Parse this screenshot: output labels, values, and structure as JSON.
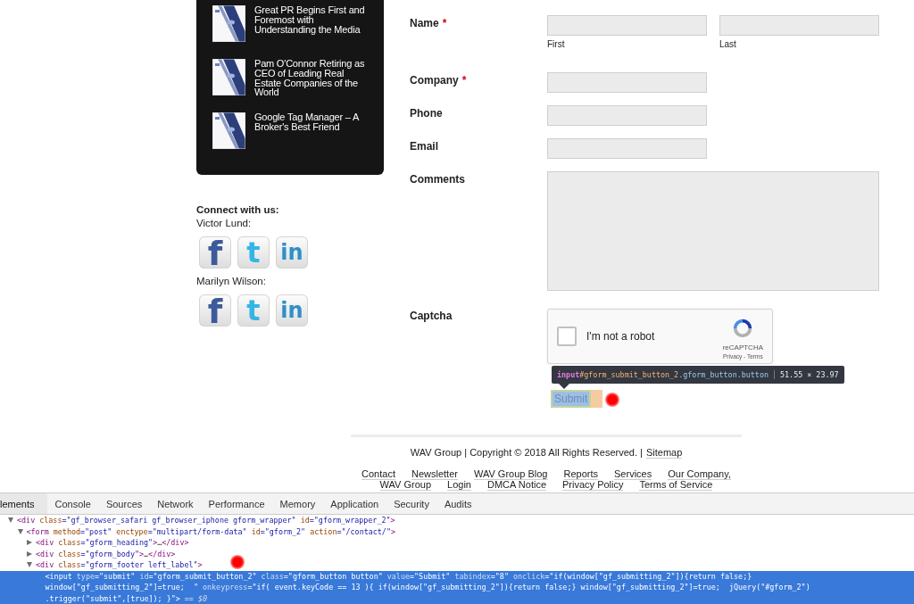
{
  "sidebar": {
    "posts": [
      {
        "title": "Great PR Begins First and Foremost with Understanding the Media"
      },
      {
        "title": "Pam O'Connor Retiring as CEO of Leading Real Estate Companies of the World"
      },
      {
        "title": "Google Tag Manager – A Broker's Best Friend"
      }
    ],
    "connect": {
      "heading": "Connect with us:",
      "people": [
        {
          "name": "Victor Lund:",
          "networks": [
            {
              "kind": "facebook",
              "glyph": "f"
            },
            {
              "kind": "twitter",
              "glyph": "t"
            },
            {
              "kind": "linkedin",
              "glyph": "in"
            }
          ]
        },
        {
          "name": "Marilyn Wilson:",
          "networks": [
            {
              "kind": "facebook",
              "glyph": "f"
            },
            {
              "kind": "twitter",
              "glyph": "t"
            },
            {
              "kind": "linkedin",
              "glyph": "in"
            }
          ]
        }
      ]
    }
  },
  "form": {
    "fields": [
      {
        "kind": "name",
        "label": "Name",
        "asterisk": "*",
        "sublabels": [
          "First",
          "Last"
        ]
      },
      {
        "kind": "text",
        "label": "Company",
        "asterisk": "*"
      },
      {
        "kind": "text",
        "label": "Phone"
      },
      {
        "kind": "text",
        "label": "Email"
      },
      {
        "kind": "textarea",
        "label": "Comments"
      },
      {
        "kind": "captcha",
        "label": "Captcha",
        "checked": false,
        "prompt": "I'm not a robot",
        "brand": "reCAPTCHA",
        "legal": "Privacy - Terms"
      }
    ],
    "inspector_tooltip": {
      "tag": "input",
      "id": "#gform_submit_button_2",
      "classes": ".gform_button.button",
      "size": "51.55 × 23.97"
    },
    "submit": {
      "label": "Submit"
    }
  },
  "footer": {
    "copyright": "WAV Group | Copyright © 2018 All Rights Reserved. |",
    "sitemap": "Sitemap",
    "link_rows": [
      [
        "Contact",
        "Newsletter",
        "WAV Group Blog",
        "Reports",
        "Services",
        "Our Company,"
      ],
      [
        "WAV Group",
        "Login",
        "DMCA Notice",
        "Privacy Policy",
        "Terms of Service"
      ]
    ]
  },
  "devtools": {
    "tabs": [
      {
        "label": "lements",
        "selected": true
      },
      {
        "label": "Console",
        "selected": false
      },
      {
        "label": "Sources",
        "selected": false
      },
      {
        "label": "Network",
        "selected": false
      },
      {
        "label": "Performance",
        "selected": false
      },
      {
        "label": "Memory",
        "selected": false
      },
      {
        "label": "Application",
        "selected": false
      },
      {
        "label": "Security",
        "selected": false
      },
      {
        "label": "Audits",
        "selected": false
      }
    ],
    "dom_tree": [
      {
        "expanded": true,
        "selected": false,
        "lines": [
          [
            {
              "kind": "tag",
              "text": "<div"
            },
            {
              "kind": "attr",
              "text": " class"
            },
            {
              "kind": "value",
              "text": "=\"gf_browser_safari gf_browser_iphone gform_wrapper\""
            },
            {
              "kind": "attr",
              "text": " id"
            },
            {
              "kind": "value",
              "text": "=\"gform_wrapper_2\""
            },
            {
              "kind": "tag",
              "text": ">"
            }
          ]
        ],
        "children": [
          {
            "expanded": true,
            "selected": false,
            "lines": [
              [
                {
                  "kind": "tag",
                  "text": "<form"
                },
                {
                  "kind": "attr",
                  "text": " method"
                },
                {
                  "kind": "value",
                  "text": "=\"post\""
                },
                {
                  "kind": "attr",
                  "text": " enctype"
                },
                {
                  "kind": "value",
                  "text": "=\"multipart/form-data\""
                },
                {
                  "kind": "attr",
                  "text": " id"
                },
                {
                  "kind": "value",
                  "text": "=\"gform_2\""
                },
                {
                  "kind": "attr",
                  "text": " action"
                },
                {
                  "kind": "value",
                  "text": "=\"/contact/\""
                },
                {
                  "kind": "tag",
                  "text": ">"
                }
              ]
            ],
            "children": [
              {
                "expanded": false,
                "selected": false,
                "lines": [
                  [
                    {
                      "kind": "tag",
                      "text": "<div"
                    },
                    {
                      "kind": "attr",
                      "text": " class"
                    },
                    {
                      "kind": "value",
                      "text": "=\"gform_heading\""
                    },
                    {
                      "kind": "tag",
                      "text": ">"
                    },
                    {
                      "kind": "text",
                      "text": "…"
                    },
                    {
                      "kind": "tag",
                      "text": "</div>"
                    }
                  ]
                ]
              },
              {
                "expanded": false,
                "selected": false,
                "lines": [
                  [
                    {
                      "kind": "tag",
                      "text": "<div"
                    },
                    {
                      "kind": "attr",
                      "text": " class"
                    },
                    {
                      "kind": "value",
                      "text": "=\"gform_body\""
                    },
                    {
                      "kind": "tag",
                      "text": ">"
                    },
                    {
                      "kind": "text",
                      "text": "…"
                    },
                    {
                      "kind": "tag",
                      "text": "</div>"
                    }
                  ]
                ]
              },
              {
                "expanded": true,
                "selected": false,
                "lines": [
                  [
                    {
                      "kind": "tag",
                      "text": "<div"
                    },
                    {
                      "kind": "attr",
                      "text": " class"
                    },
                    {
                      "kind": "value",
                      "text": "=\"gform_footer left_label\""
                    },
                    {
                      "kind": "tag",
                      "text": ">"
                    }
                  ]
                ],
                "children": [
                  {
                    "selected": true,
                    "lines": [
                      [
                        {
                          "kind": "tag",
                          "text": "<input"
                        },
                        {
                          "kind": "attr",
                          "text": " type"
                        },
                        {
                          "kind": "value",
                          "text": "=\"submit\""
                        },
                        {
                          "kind": "attr",
                          "text": " id"
                        },
                        {
                          "kind": "value",
                          "text": "=\"gform_submit_button_2\""
                        },
                        {
                          "kind": "attr",
                          "text": " class"
                        },
                        {
                          "kind": "value",
                          "text": "=\"gform_button button\""
                        },
                        {
                          "kind": "attr",
                          "text": " value"
                        },
                        {
                          "kind": "value",
                          "text": "=\"Submit\""
                        },
                        {
                          "kind": "attr",
                          "text": " tabindex"
                        },
                        {
                          "kind": "value",
                          "text": "=\"8\""
                        },
                        {
                          "kind": "attr",
                          "text": " onclick"
                        },
                        {
                          "kind": "value",
                          "text": "=\"if(window[\"gf_submitting_2\"]){return false;}"
                        }
                      ],
                      [
                        {
                          "kind": "value",
                          "text": "window[\"gf_submitting_2\"]=true;  \""
                        },
                        {
                          "kind": "attr",
                          "text": " onkeypress"
                        },
                        {
                          "kind": "value",
                          "text": "=\"if( event.keyCode == 13 ){ if(window[\"gf_submitting_2\"]){return false;} window[\"gf_submitting_2\"]=true;  jQuery(\"#gform_2\")"
                        }
                      ],
                      [
                        {
                          "kind": "value",
                          "text": ".trigger(\"submit\",[true]); }\""
                        },
                        {
                          "kind": "tag",
                          "text": ">"
                        },
                        {
                          "kind": "marker",
                          "text": " == $0"
                        }
                      ]
                    ]
                  }
                ]
              }
            ]
          }
        ]
      }
    ]
  }
}
